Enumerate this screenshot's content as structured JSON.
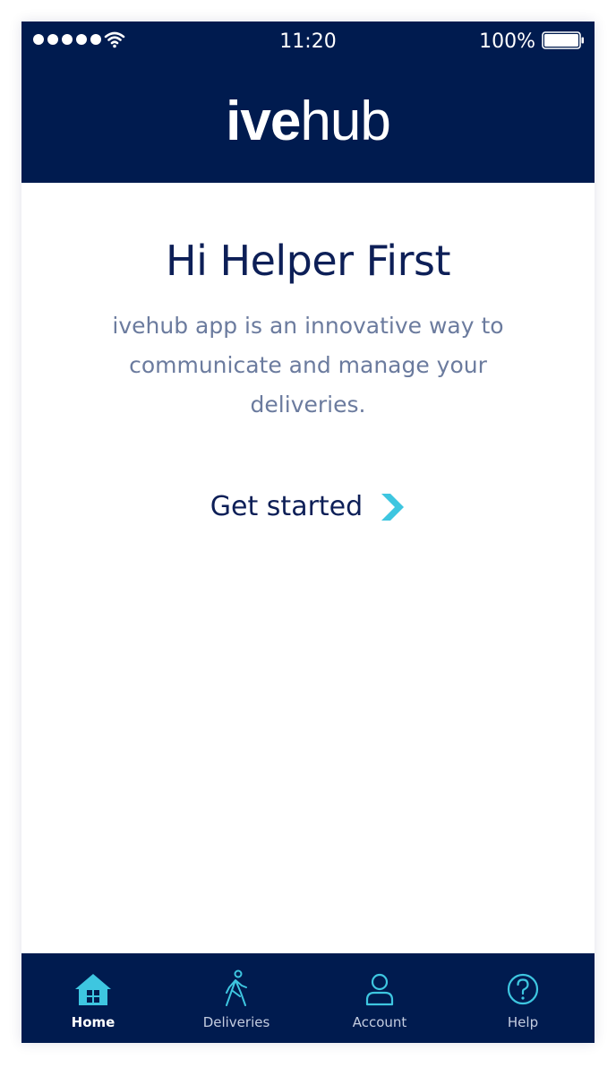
{
  "status_bar": {
    "time": "11:20",
    "battery_percent": "100%",
    "battery_level": 1.0,
    "signal_bars": 5
  },
  "header": {
    "logo_bold": "ive",
    "logo_light": "hub"
  },
  "main": {
    "greeting": "Hi Helper First",
    "intro": "ivehub app is an innovative way to communicate and manage your deliveries.",
    "cta_label": "Get started",
    "cta_icon": "chevron-right-icon"
  },
  "tabbar": {
    "items": [
      {
        "label": "Home",
        "icon": "home-icon",
        "active": true
      },
      {
        "label": "Deliveries",
        "icon": "walking-person-icon",
        "active": false
      },
      {
        "label": "Account",
        "icon": "user-icon",
        "active": false
      },
      {
        "label": "Help",
        "icon": "question-circle-icon",
        "active": false
      }
    ]
  },
  "colors": {
    "brand_navy": "#001b4f",
    "accent_cyan": "#3ec6e0",
    "text_dark": "#0d1f57",
    "text_muted": "#6b7b9e"
  }
}
